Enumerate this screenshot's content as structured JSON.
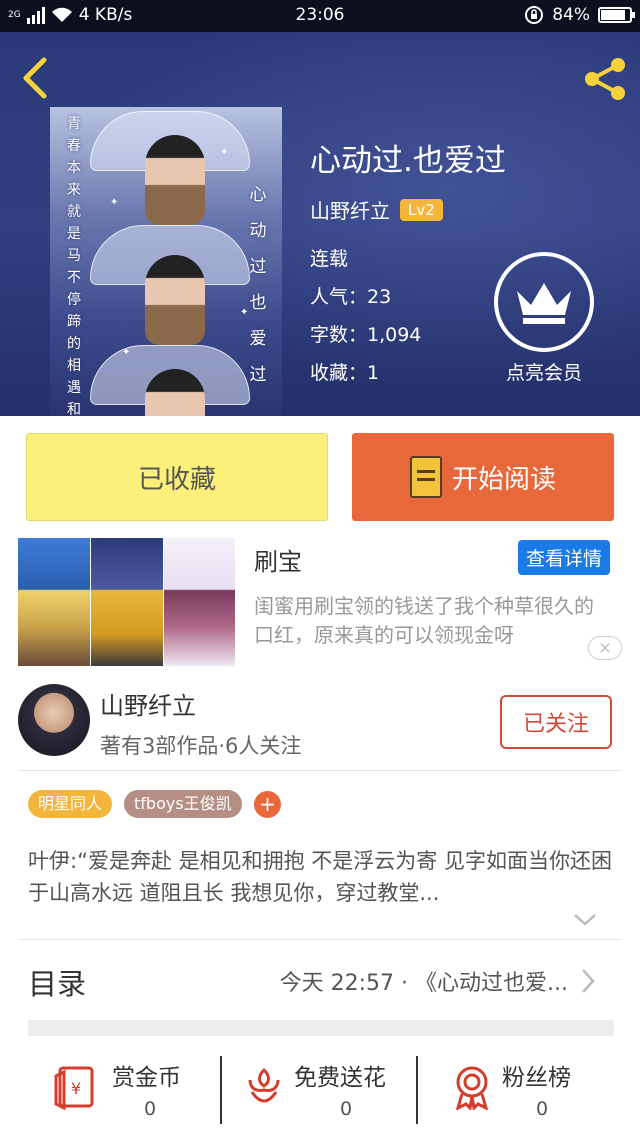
{
  "status_bar": {
    "network": "2G",
    "speed": "4 KB/s",
    "time": "23:06",
    "battery": "84%",
    "battery_level": 0.84
  },
  "book": {
    "title": "心动过.也爱过",
    "author": "山野纤立",
    "author_level": "Lv2",
    "status": "连载",
    "popularity": "人气：23",
    "word_count": "字数：1,094",
    "favorites": "收藏：1",
    "cover_text_left": "青春本来就是马不停蹄的相遇和告",
    "cover_text_right": "心动过也爱过"
  },
  "vip": {
    "label": "点亮会员",
    "icon": "crown-icon"
  },
  "actions": {
    "collected_label": "已收藏",
    "read_label": "开始阅读"
  },
  "ad": {
    "title": "刷宝",
    "button": "查看详情",
    "description": "闺蜜用刷宝领的钱送了我个种草很久的口红，原来真的可以领现金呀",
    "close": "×"
  },
  "author": {
    "name": "山野纤立",
    "meta": "著有3部作品·6人关注",
    "follow_label": "已关注"
  },
  "tags": [
    {
      "label": "明星同人",
      "color": "#f3b53b"
    },
    {
      "label": "tfboys王俊凯",
      "color": "#b58f84"
    }
  ],
  "tag_add": "+",
  "summary": "叶伊:“爱是奔赴 是相见和拥抱 不是浮云为寄 见字如面当你还困于山高水远 道阻且长 我想见你，穿过教堂...",
  "toc": {
    "label": "目录",
    "latest": "今天 22:57 · 《心动过也爱..."
  },
  "bottom_bar": [
    {
      "label": "赏金币",
      "value": "0",
      "icon": "coin-envelope-icon"
    },
    {
      "label": "免费送花",
      "value": "0",
      "icon": "flower-icon"
    },
    {
      "label": "粉丝榜",
      "value": "0",
      "icon": "medal-icon"
    }
  ],
  "colors": {
    "header_bg": "#2f3d80",
    "accent_orange": "#e9683b",
    "collected_yellow": "#faf07a",
    "follow_red": "#d24a3a",
    "ad_blue": "#1a7be8"
  }
}
